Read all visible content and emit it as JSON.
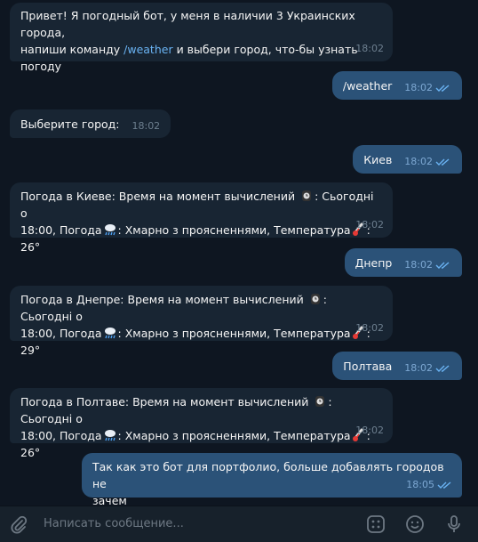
{
  "messages": {
    "m1": {
      "line1": "Привет! Я погодный бот, у меня в наличии 3 Украинских города,",
      "line2a": "напиши команду ",
      "command": "/weather",
      "line2b": " и выбери город, что-бы узнать",
      "line3": "погоду",
      "time": "18:02"
    },
    "m2": {
      "text": "/weather",
      "time": "18:02"
    },
    "m3": {
      "text": "Выберите город:",
      "time": "18:02"
    },
    "m4": {
      "text": "Киев",
      "time": "18:02"
    },
    "m5": {
      "l1": "Погода в Киеве: Время на момент вычислений",
      "l1b": ": Сьогодні о",
      "l2a": "18:00, Погода",
      "l2b": ": Хмарно з проясненнями, Температура",
      "l2c": ": 26°",
      "time": "18:02"
    },
    "m6": {
      "text": "Днепр",
      "time": "18:02"
    },
    "m7": {
      "l1": "Погода в Днепре: Время на момент вычислений",
      "l1b": ": Сьогодні о",
      "l2a": "18:00, Погода",
      "l2b": ": Хмарно з проясненнями, Температура",
      "l2c": ": 29°",
      "time": "18:02"
    },
    "m8": {
      "text": "Полтава",
      "time": "18:02"
    },
    "m9": {
      "l1": "Погода в Полтаве: Время на момент вычислений",
      "l1b": ": Сьогодні о",
      "l2a": "18:00, Погода",
      "l2b": ": Хмарно з проясненнями, Температура",
      "l2c": ": 26°",
      "time": "18:02"
    },
    "m10": {
      "line1": "Так как это бот для портфолио, больше добавлять городов не",
      "line2": "зачем",
      "time": "18:05"
    }
  },
  "composer": {
    "placeholder": "Написать сообщение..."
  },
  "icons": {
    "attach": "paperclip-icon",
    "commands": "bot-commands-icon",
    "emoji": "emoji-icon",
    "mic": "microphone-icon"
  }
}
